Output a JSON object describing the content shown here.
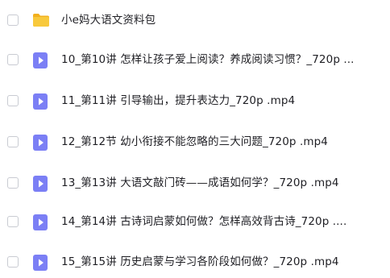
{
  "file_list": {
    "items": [
      {
        "name": "小e妈大语文资料包",
        "type": "folder",
        "icon": "folder-icon",
        "checked": false
      },
      {
        "name": "10_第10讲 怎样让孩子爱上阅读？养成阅读习惯？_720p ...",
        "type": "video",
        "icon": "video-file-icon",
        "checked": false
      },
      {
        "name": "11_第11讲 引导输出，提升表达力_720p .mp4",
        "type": "video",
        "icon": "video-file-icon",
        "checked": false
      },
      {
        "name": "12_第12节 幼小衔接不能忽略的三大问题_720p .mp4",
        "type": "video",
        "icon": "video-file-icon",
        "checked": false
      },
      {
        "name": "13_第13讲 大语文敲门砖——成语如何学？_720p .mp4",
        "type": "video",
        "icon": "video-file-icon",
        "checked": false
      },
      {
        "name": "14_第14讲 古诗词启蒙如何做？怎样高效背古诗_720p ....",
        "type": "video",
        "icon": "video-file-icon",
        "checked": false
      },
      {
        "name": "15_第15讲 历史启蒙与学习各阶段如何做？_720p .mp4",
        "type": "video",
        "icon": "video-file-icon",
        "checked": false
      }
    ]
  },
  "colors": {
    "folder": "#f8c93c",
    "folder_tab": "#f2b01e",
    "video_icon": "#7b7ff5",
    "video_play": "#ffffff",
    "checkbox_border": "#c9cbd2",
    "text": "#1f1f24"
  }
}
